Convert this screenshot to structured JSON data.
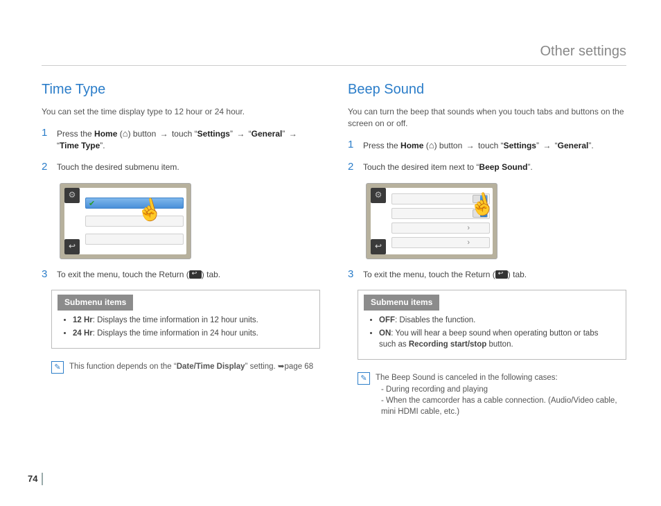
{
  "header": "Other settings",
  "pageNumber": "74",
  "left": {
    "title": "Time Type",
    "intro": "You can set the time display type to 12 hour or 24 hour.",
    "step1_a": "Press the ",
    "step1_home": "Home",
    "step1_b": " button ",
    "step1_touch": " touch “",
    "step1_settings": "Settings",
    "step1_c": "” ",
    "step1_general": "General",
    "step1_d": "” ",
    "step1_timetype": "Time Type",
    "step1_end": "”.",
    "step2": "Touch the desired submenu item.",
    "step3_a": "To exit the menu, touch the Return (",
    "step3_b": ") tab.",
    "submenuLabel": "Submenu items",
    "sub_12_b": "12 Hr",
    "sub_12_t": ": Displays the time information in 12 hour units.",
    "sub_24_b": "24 Hr",
    "sub_24_t": ": Displays the time information in 24 hour units.",
    "note_a": "This function depends on the “",
    "note_b": "Date/Time Display",
    "note_c": "” setting. ",
    "note_page": "➥page 68"
  },
  "right": {
    "title": "Beep Sound",
    "intro": "You can turn the beep that sounds when you touch tabs and buttons on the screen on or off.",
    "step1_a": "Press the ",
    "step1_home": "Home",
    "step1_b": " button ",
    "step1_touch": " touch “",
    "step1_settings": "Settings",
    "step1_c": "” ",
    "step1_general": "General",
    "step1_end": "”.",
    "step2_a": "Touch the desired item next to “",
    "step2_b": "Beep Sound",
    "step2_c": "”.",
    "step3_a": "To exit the menu, touch the Return (",
    "step3_b": ") tab.",
    "submenuLabel": "Submenu items",
    "sub_off_b": "OFF",
    "sub_off_t": ": Disables the function.",
    "sub_on_b": "ON",
    "sub_on_t": ": You will hear a beep sound when operating button or tabs such as ",
    "sub_on_rec": "Recording start/stop",
    "sub_on_end": " button.",
    "note_head": "The Beep Sound is canceled in the following cases:",
    "note_l1": "- During recording and playing",
    "note_l2": "- When the camcorder has a cable connection. (Audio/Video cable, mini HDMI cable, etc.)"
  }
}
